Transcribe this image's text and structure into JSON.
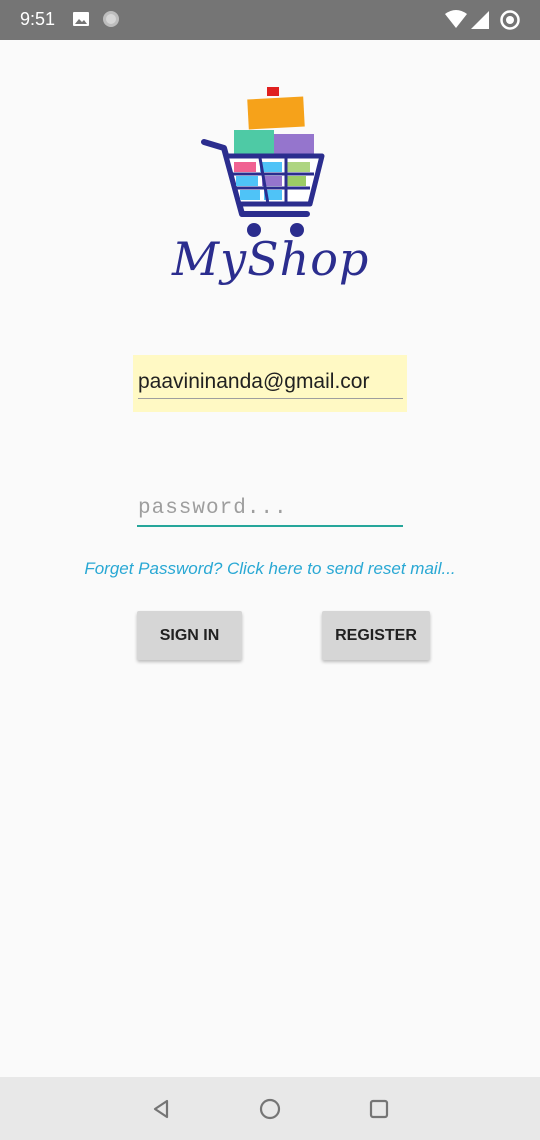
{
  "status_bar": {
    "time": "9:51",
    "icons": [
      "image-icon",
      "circle-icon",
      "wifi-icon",
      "signal-icon",
      "sync-icon"
    ]
  },
  "logo": {
    "text": "MyShop",
    "icon": "shopping-cart-icon"
  },
  "login": {
    "email_value": "paavininanda@gmail.cor",
    "password_placeholder": "password...",
    "forgot_text": "Forget Password? Click here to send reset mail...",
    "sign_in_label": "SIGN IN",
    "register_label": "REGISTER"
  },
  "colors": {
    "email_highlight": "#fff9c4",
    "accent": "#26a69a",
    "link": "#29a8d4",
    "logo_text": "#2b2d8e"
  },
  "nav_bar": {
    "icons": [
      "back-icon",
      "home-icon",
      "recents-icon"
    ]
  }
}
